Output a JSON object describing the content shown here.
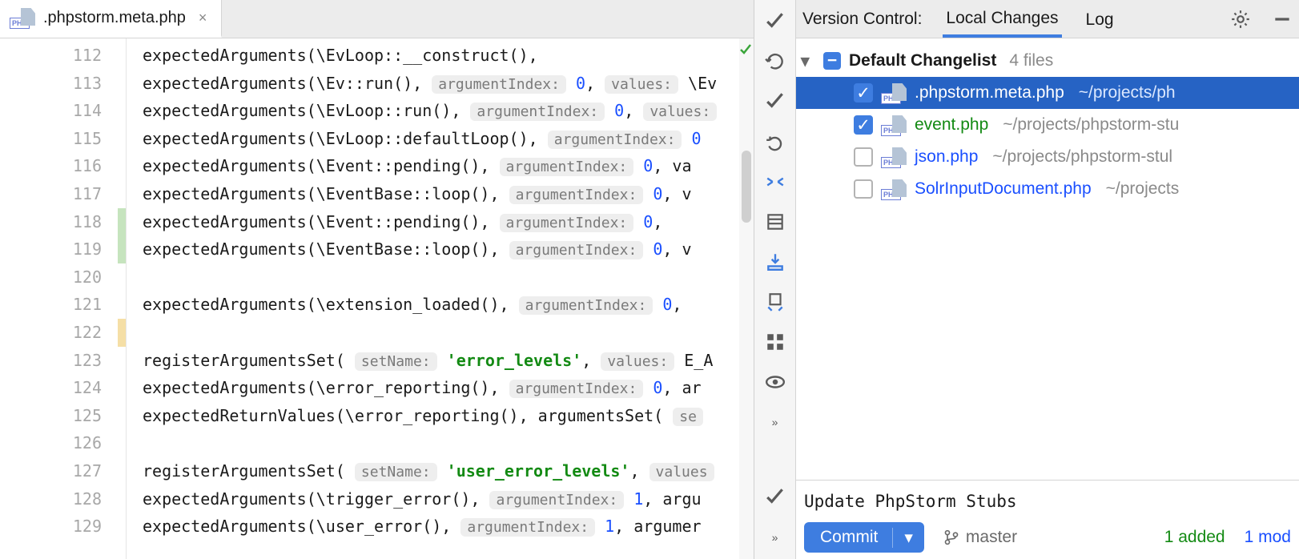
{
  "tab": {
    "filename": ".phpstorm.meta.php"
  },
  "gutter": {
    "lines": [
      "112",
      "113",
      "114",
      "115",
      "116",
      "117",
      "118",
      "119",
      "120",
      "121",
      "122",
      "123",
      "124",
      "125",
      "126",
      "127",
      "128",
      "129"
    ]
  },
  "code": {
    "l112": "expectedArguments(\\EvLoop::__construct(),",
    "l113a": "expectedArguments(\\Ev::run(),",
    "h113a": "argumentIndex:",
    "n113a": "0",
    "c113a": ",",
    "h113b": "values:",
    "t113b": " \\Ev",
    "l114a": "expectedArguments(\\EvLoop::run(),",
    "h114a": "argumentIndex:",
    "n114a": "0",
    "c114a": ",",
    "h114b": "values:",
    "l115a": "expectedArguments(\\EvLoop::defaultLoop(),",
    "h115a": "argumentIndex:",
    "n115a": "0",
    "l116a": "expectedArguments(\\Event::pending(),",
    "h116a": "argumentIndex:",
    "n116a": "0",
    "c116a": ",",
    "t116b": " va",
    "l117a": "expectedArguments(\\EventBase::loop(),",
    "h117a": "argumentIndex:",
    "n117a": "0",
    "c117a": ",",
    "t117b": " v",
    "l118a": "expectedArguments(\\Event::pending(),",
    "h118a": "argumentIndex:",
    "n118a": "0",
    "c118a": ",",
    "l119a": "expectedArguments(\\EventBase::loop(),",
    "h119a": "argumentIndex:",
    "n119a": "0",
    "c119a": ",",
    "t119b": " v",
    "l121a": "expectedArguments(\\extension_loaded(),",
    "h121a": "argumentIndex:",
    "n121a": "0",
    "c121a": ",",
    "l123a": "registerArgumentsSet(",
    "h123a": "setName:",
    "s123a": "'error_levels'",
    "c123a": ",",
    "h123b": "values:",
    "t123b": " E_A",
    "l124a": "expectedArguments(\\error_reporting(),",
    "h124a": "argumentIndex:",
    "n124a": "0",
    "t124b": ", ar",
    "l125a": "expectedReturnValues(\\error_reporting(), argumentsSet(",
    "h125a": "se",
    "l127a": "registerArgumentsSet(",
    "h127a": "setName:",
    "s127a": "'user_error_levels'",
    "c127a": ",",
    "h127b": "values",
    "l128a": "expectedArguments(\\trigger_error(),",
    "h128a": "argumentIndex:",
    "n128a": "1",
    "t128b": ", argu",
    "l129a": "expectedArguments(\\user_error(),",
    "h129a": "argumentIndex:",
    "n129a": "1",
    "t129b": ", argumer"
  },
  "vcs": {
    "title": "Version Control:",
    "tab_local": "Local Changes",
    "tab_log": "Log",
    "changelist": "Default Changelist",
    "files_count": "4 files",
    "files": [
      {
        "name": ".phpstorm.meta.php",
        "path": "~/projects/ph",
        "checked": true,
        "selected": true,
        "color": "blue"
      },
      {
        "name": "event.php",
        "path": "~/projects/phpstorm-stu",
        "checked": true,
        "selected": false,
        "color": "green"
      },
      {
        "name": "json.php",
        "path": "~/projects/phpstorm-stul",
        "checked": false,
        "selected": false,
        "color": "blue"
      },
      {
        "name": "SolrInputDocument.php",
        "path": "~/projects",
        "checked": false,
        "selected": false,
        "color": "blue"
      }
    ],
    "commit_message": "Update PhpStorm Stubs",
    "commit_btn": "Commit",
    "branch": "master",
    "added": "1 added",
    "modified": "1 mod"
  }
}
